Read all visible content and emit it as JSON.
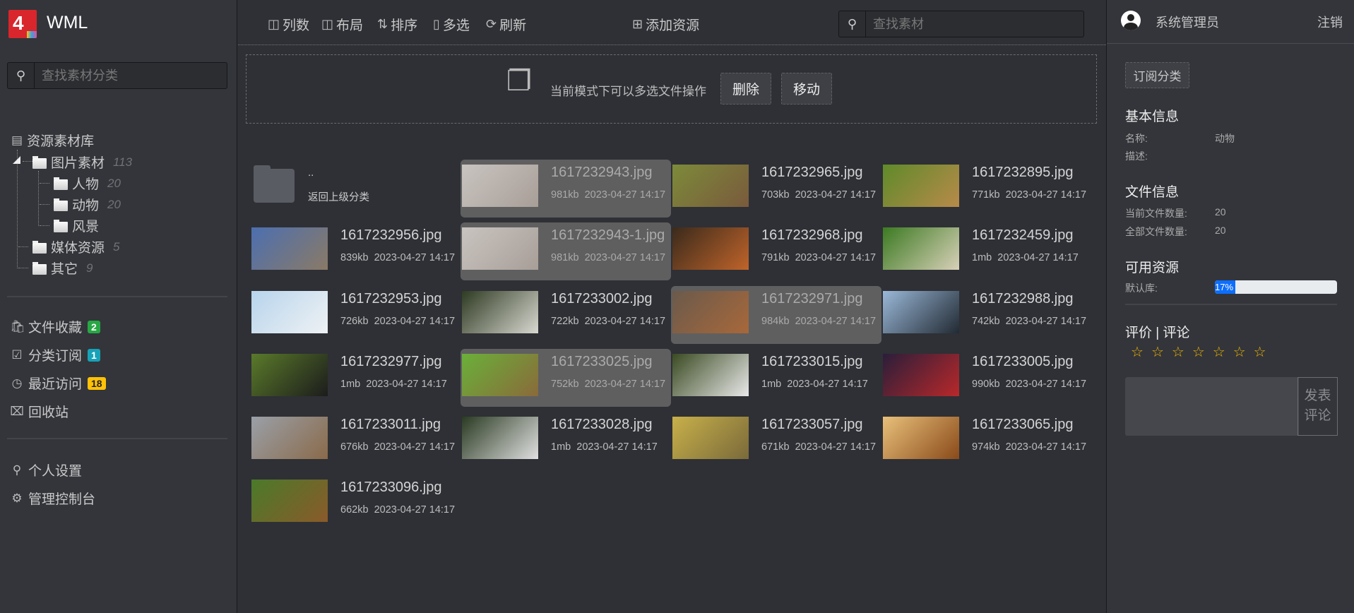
{
  "brand": {
    "name": "WML",
    "logo_text": "4"
  },
  "sidebar": {
    "search_placeholder": "查找素材分类",
    "tree_root": "资源素材库",
    "tree": [
      {
        "label": "图片素材",
        "count": "113"
      },
      {
        "label": "人物",
        "count": "20"
      },
      {
        "label": "动物",
        "count": "20"
      },
      {
        "label": "风景",
        "count": ""
      },
      {
        "label": "媒体资源",
        "count": "5"
      },
      {
        "label": "其它",
        "count": "9"
      }
    ],
    "menu": [
      {
        "label": "文件收藏",
        "badge": "2",
        "badge_color": "#28a745"
      },
      {
        "label": "分类订阅",
        "badge": "1",
        "badge_color": "#17a2b8"
      },
      {
        "label": "最近访问",
        "badge": "18",
        "badge_color": "#ffc107"
      },
      {
        "label": "回收站",
        "badge": ""
      }
    ],
    "menu2": [
      {
        "label": "个人设置"
      },
      {
        "label": "管理控制台"
      }
    ]
  },
  "toolbar": {
    "columns": "列数",
    "layout": "布局",
    "sort": "排序",
    "multi": "多选",
    "refresh": "刷新",
    "add": "添加资源",
    "search_placeholder": "查找素材"
  },
  "multi_bar": {
    "text": "当前模式下可以多选文件操作",
    "delete": "删除",
    "move": "移动"
  },
  "parent": {
    "name": "..",
    "label": "返回上级分类"
  },
  "files": [
    {
      "name": "1617232943.jpg",
      "size": "981kb",
      "date": "2023-04-27 14:17",
      "selected": true,
      "c": [
        "#c9c4c0",
        "#a89e98"
      ]
    },
    {
      "name": "1617232965.jpg",
      "size": "703kb",
      "date": "2023-04-27 14:17",
      "selected": false,
      "c": [
        "#7c8a3a",
        "#7a5a3c"
      ]
    },
    {
      "name": "1617232895.jpg",
      "size": "771kb",
      "date": "2023-04-27 14:17",
      "selected": false,
      "c": [
        "#5f8a2a",
        "#b88a4a"
      ]
    },
    {
      "name": "1617232956.jpg",
      "size": "839kb",
      "date": "2023-04-27 14:17",
      "selected": false,
      "c": [
        "#4c6fb0",
        "#8a7a66"
      ]
    },
    {
      "name": "1617232943-1.jpg",
      "size": "981kb",
      "date": "2023-04-27 14:17",
      "selected": true,
      "c": [
        "#c9c4c0",
        "#a89e98"
      ]
    },
    {
      "name": "1617232968.jpg",
      "size": "791kb",
      "date": "2023-04-27 14:17",
      "selected": false,
      "c": [
        "#3a2a1c",
        "#c0642a"
      ]
    },
    {
      "name": "1617232459.jpg",
      "size": "1mb",
      "date": "2023-04-27 14:17",
      "selected": false,
      "c": [
        "#3c7a22",
        "#d8d0b8"
      ]
    },
    {
      "name": "1617232953.jpg",
      "size": "726kb",
      "date": "2023-04-27 14:17",
      "selected": false,
      "c": [
        "#b8d4ec",
        "#eef2f4"
      ]
    },
    {
      "name": "1617233002.jpg",
      "size": "722kb",
      "date": "2023-04-27 14:17",
      "selected": false,
      "c": [
        "#2e3a22",
        "#d8d8d0"
      ]
    },
    {
      "name": "1617232971.jpg",
      "size": "984kb",
      "date": "2023-04-27 14:17",
      "selected": true,
      "c": [
        "#6a5a4c",
        "#a8683a"
      ]
    },
    {
      "name": "1617232988.jpg",
      "size": "742kb",
      "date": "2023-04-27 14:17",
      "selected": false,
      "c": [
        "#9ab8d8",
        "#222a33"
      ]
    },
    {
      "name": "1617232977.jpg",
      "size": "1mb",
      "date": "2023-04-27 14:17",
      "selected": false,
      "c": [
        "#5a7a2a",
        "#1c1c1c"
      ]
    },
    {
      "name": "1617233025.jpg",
      "size": "752kb",
      "date": "2023-04-27 14:17",
      "selected": true,
      "c": [
        "#6ab03a",
        "#8a6a3a"
      ]
    },
    {
      "name": "1617233015.jpg",
      "size": "1mb",
      "date": "2023-04-27 14:17",
      "selected": false,
      "c": [
        "#3a4a22",
        "#e8e8e8"
      ]
    },
    {
      "name": "1617233005.jpg",
      "size": "990kb",
      "date": "2023-04-27 14:17",
      "selected": false,
      "c": [
        "#2a1e3a",
        "#b8282a"
      ]
    },
    {
      "name": "1617233011.jpg",
      "size": "676kb",
      "date": "2023-04-27 14:17",
      "selected": false,
      "c": [
        "#9aa0a8",
        "#8a6a4a"
      ]
    },
    {
      "name": "1617233028.jpg",
      "size": "1mb",
      "date": "2023-04-27 14:17",
      "selected": false,
      "c": [
        "#2a3a22",
        "#e0e0e0"
      ]
    },
    {
      "name": "1617233057.jpg",
      "size": "671kb",
      "date": "2023-04-27 14:17",
      "selected": false,
      "c": [
        "#c8b04a",
        "#7a6a3a"
      ]
    },
    {
      "name": "1617233065.jpg",
      "size": "974kb",
      "date": "2023-04-27 14:17",
      "selected": false,
      "c": [
        "#e8c07a",
        "#8a4a1a"
      ]
    },
    {
      "name": "1617233096.jpg",
      "size": "662kb",
      "date": "2023-04-27 14:17",
      "selected": false,
      "c": [
        "#4a7a2a",
        "#8a5a2a"
      ]
    }
  ],
  "user": {
    "name": "系统管理员",
    "logout": "注销"
  },
  "details": {
    "subscribe": "订阅分类",
    "basic_title": "基本信息",
    "name_label": "名称:",
    "name_value": "动物",
    "desc_label": "描述:",
    "file_title": "文件信息",
    "current_label": "当前文件数量:",
    "current_value": "20",
    "total_label": "全部文件数量:",
    "total_value": "20",
    "res_title": "可用资源",
    "lib_label": "默认库:",
    "usage_percent": 17,
    "usage_text": "17%",
    "review_title": "评价 | 评论",
    "stars_total": 7,
    "stars_filled": 0,
    "post": "发表评论"
  }
}
